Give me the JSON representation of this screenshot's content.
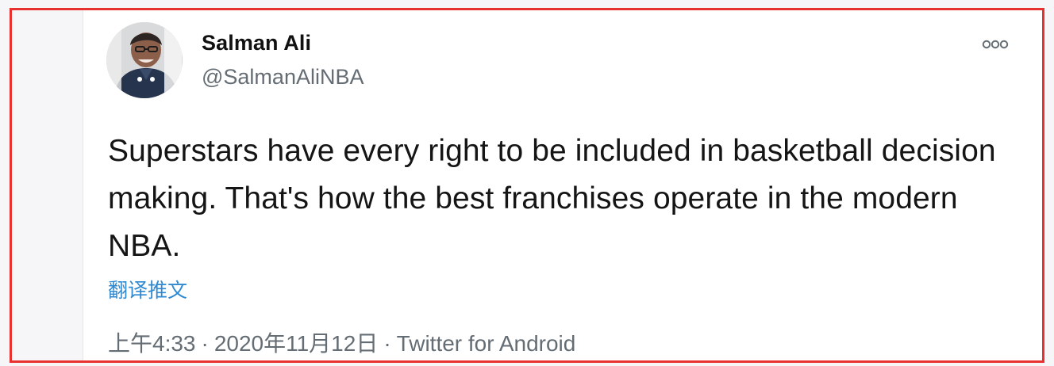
{
  "tweet": {
    "author": {
      "display_name": "Salman Ali",
      "handle": "@SalmanAliNBA",
      "avatar_icon": "profile-photo"
    },
    "text": "Superstars have every right to be included in basketball decision making. That's how the best franchises operate in the modern NBA.",
    "translate_label": "翻译推文",
    "meta": {
      "time": "上午4:33",
      "date": "2020年11月12日",
      "separator": "·",
      "source": "Twitter for Android"
    },
    "more_icon": "more-options"
  },
  "colors": {
    "highlight_border": "#e8322f",
    "link": "#2f89d1",
    "secondary_text": "#656d74",
    "primary_text": "#151515"
  }
}
